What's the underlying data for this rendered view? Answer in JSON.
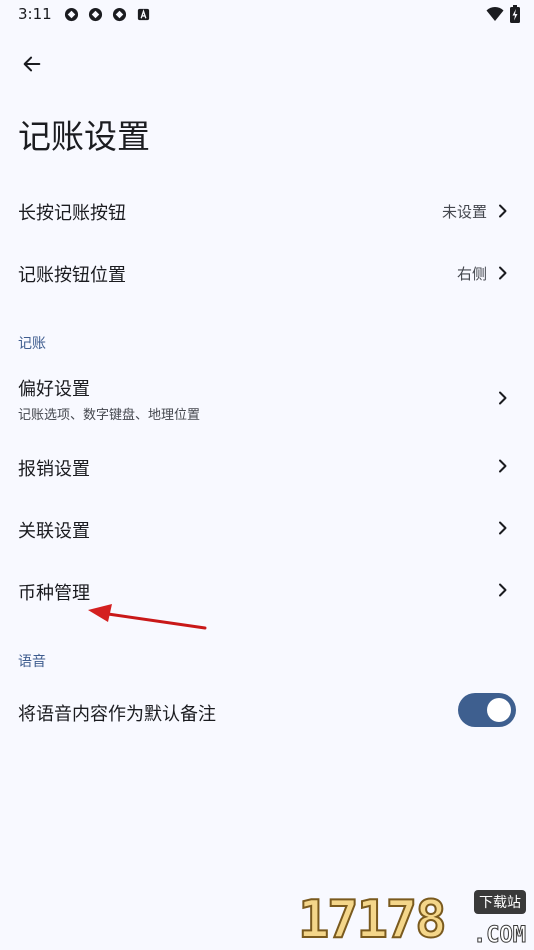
{
  "status_bar": {
    "time": "3:11",
    "left_icons": [
      "app-notification-icon",
      "app-notification-icon",
      "app-notification-icon",
      "a-square-icon"
    ],
    "right_icons": [
      "wifi-icon",
      "battery-charging-icon"
    ]
  },
  "header": {
    "back_icon": "arrow-left-icon",
    "title": "记账设置"
  },
  "items": {
    "long_press": {
      "label": "长按记账按钮",
      "value": "未设置"
    },
    "button_position": {
      "label": "记账按钮位置",
      "value": "右侧"
    }
  },
  "section_bookkeeping": {
    "title": "记账",
    "preferences": {
      "label": "偏好设置",
      "subtitle": "记账选项、数字键盘、地理位置"
    },
    "reimbursement": {
      "label": "报销设置"
    },
    "association": {
      "label": "关联设置"
    },
    "currency": {
      "label": "币种管理"
    }
  },
  "section_voice": {
    "title": "语音",
    "voice_note": {
      "label": "将语音内容作为默认备注",
      "enabled": true
    }
  },
  "watermark": {
    "digits": "17178",
    "tag": "下载站",
    "domain": ".COM"
  },
  "colors": {
    "background": "#f8f9ff",
    "section_header": "#3f5d8f",
    "toggle_on": "#3e5f8f",
    "annotation_arrow": "#d42020"
  }
}
